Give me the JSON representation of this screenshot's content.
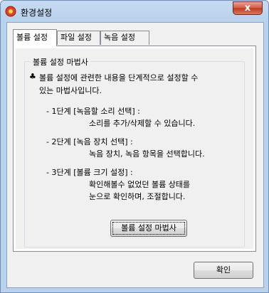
{
  "window": {
    "title": "환경설정",
    "close_label": "x"
  },
  "tabs": [
    {
      "label": "볼륨 설정"
    },
    {
      "label": "파일 설정"
    },
    {
      "label": "녹음 설정"
    }
  ],
  "groupbox": {
    "legend": "볼륨 설정 마법사",
    "intro_bullet": "♣",
    "intro_line1": "볼륨 설정에 관련한 내용을 단계적으로 설정할 수",
    "intro_line2": "있는 마법사입니다.",
    "step1_title": "- 1단계 [녹음할 소리 선택] :",
    "step1_desc": "소리를 추가/삭제할 수 있습니다.",
    "step2_title": "- 2단계 [녹음 장치 선택] :",
    "step2_desc": "녹음 장치, 녹음 항목을 선택합니다.",
    "step3_title": "- 3단계 [볼륨 크기 설정] :",
    "step3_desc1": "확인해볼수 없었던 볼륨 상태를",
    "step3_desc2": "눈으로 확인하며, 조절합니다.",
    "wizard_button": "볼륨 설정 마법사"
  },
  "footer": {
    "ok_button": "확인"
  }
}
